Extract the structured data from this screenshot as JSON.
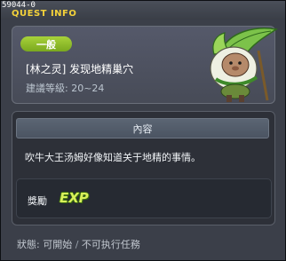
{
  "window": {
    "quest_id": "59044-0",
    "title": "QUEST INFO",
    "close_glyph": "×"
  },
  "header": {
    "category": "一般",
    "quest_name": "[林之灵] 发现地精巢穴",
    "level_label": "建議等級: 20~24",
    "npc_icon": "goblin-npc-icon"
  },
  "content": {
    "heading": "內容",
    "description": "吹牛大王汤姆好像知道关于地精的事情。",
    "reward_label": "獎勵",
    "reward_exp": "EXP"
  },
  "status": {
    "label": "狀態:",
    "state": "可開始",
    "separator": " / ",
    "note": "不可执行任務"
  },
  "colors": {
    "title": "#f4d23a",
    "category_badge": "#8fbe2a",
    "exp": "#d8f05a"
  }
}
